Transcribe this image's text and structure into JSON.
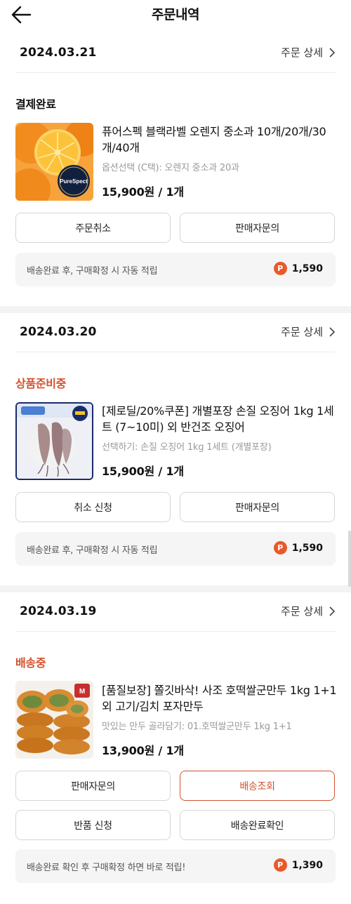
{
  "header": {
    "title": "주문내역",
    "back_icon": "arrow-left-icon"
  },
  "colors": {
    "accent": "#d4512e",
    "point_badge": "#e85a2a",
    "status_preparing": "#d4512e",
    "status_shipping": "#d4512e"
  },
  "orders": [
    {
      "date": "2024.03.21",
      "detail_label": "주문 상세",
      "status": "결제완료",
      "status_color": "#111111",
      "product": {
        "title": "퓨어스펙 블랙라벨 오렌지 중소과 10개/20개/30개/40개",
        "option": "옵션선택 (C택): 오렌지 중소과 20과",
        "price": "15,900원 / 1개",
        "image_badge": "PureSpect"
      },
      "buttons": [
        {
          "label": "주문취소"
        },
        {
          "label": "판매자문의"
        }
      ],
      "points": {
        "text": "배송완료 후, 구매확정 시 자동 적립",
        "icon": "P",
        "value": "1,590"
      }
    },
    {
      "date": "2024.03.20",
      "detail_label": "주문 상세",
      "status": "상품준비중",
      "status_color": "#d4512e",
      "product": {
        "title": "[제로딜/20%쿠폰] 개별포장 손질 오징어 1kg 1세트 (7~10미) 외 반건조 오징어",
        "option": "선택하기: 손질 오징어 1kg 1세트 (개별포장)",
        "price": "15,900원 / 1개"
      },
      "buttons": [
        {
          "label": "취소 신청"
        },
        {
          "label": "판매자문의"
        }
      ],
      "points": {
        "text": "배송완료 후, 구매확정 시 자동 적립",
        "icon": "P",
        "value": "1,590"
      }
    },
    {
      "date": "2024.03.19",
      "detail_label": "주문 상세",
      "status": "배송중",
      "status_color": "#d4512e",
      "product": {
        "title": "[품질보장] 쫄깃바삭! 사조 호떡쌀군만두 1kg 1+1 외 고기/김치 포자만두",
        "option": "맛있는 만두 골라담기: 01.호떡쌀군만두 1kg 1+1",
        "price": "13,900원 / 1개"
      },
      "buttons": [
        {
          "label": "판매자문의"
        },
        {
          "label": "배송조회"
        },
        {
          "label": "반품 신청"
        },
        {
          "label": "배송완료확인"
        }
      ],
      "points": {
        "text": "배송완료 확인 후 구매확정 하면 바로 적립!",
        "icon": "P",
        "value": "1,390"
      }
    }
  ]
}
